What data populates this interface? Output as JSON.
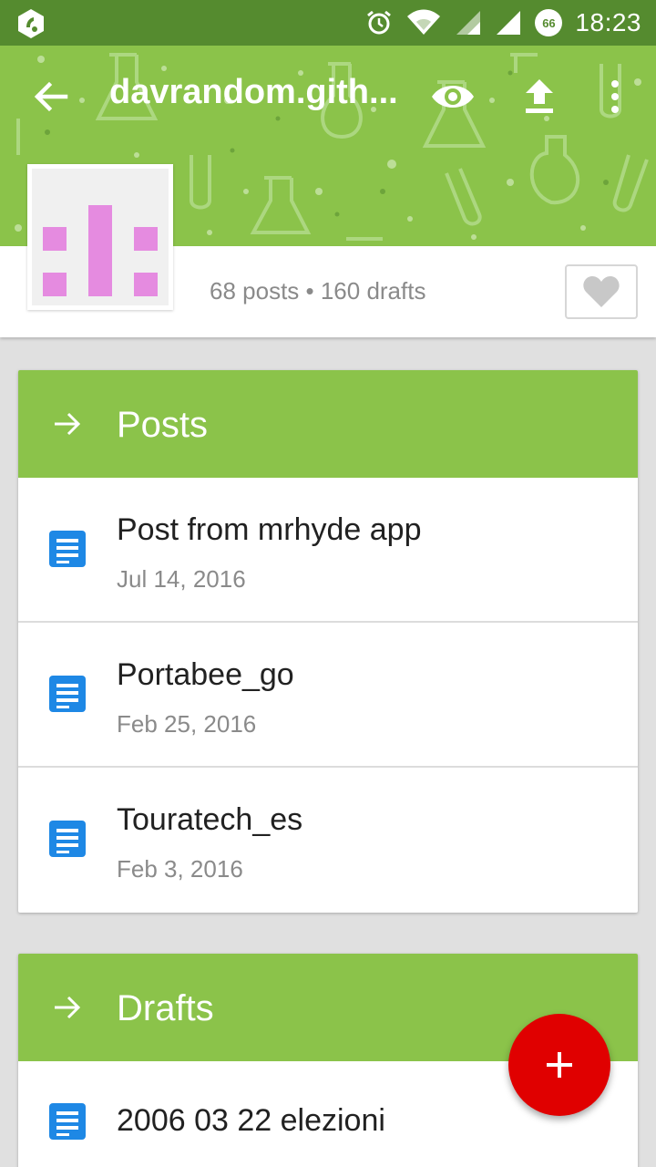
{
  "status_bar": {
    "time": "18:23",
    "battery": "66",
    "icons": [
      "notification-app-icon",
      "alarm-icon",
      "wifi-icon",
      "signal-icon",
      "battery-icon"
    ]
  },
  "toolbar": {
    "title": "davrandom.gith...",
    "actions": [
      "back-arrow-icon",
      "eye-icon",
      "upload-icon",
      "more-vert-icon"
    ]
  },
  "profile": {
    "stats": "68 posts • 160 drafts"
  },
  "posts": {
    "header": "Posts",
    "items": [
      {
        "title": "Post from mrhyde app",
        "date": "Jul 14, 2016"
      },
      {
        "title": "Portabee_go",
        "date": "Feb 25, 2016"
      },
      {
        "title": "Touratech_es",
        "date": "Feb 3, 2016"
      }
    ]
  },
  "drafts": {
    "header": "Drafts",
    "items": [
      {
        "title": "2006 03 22 elezioni"
      }
    ]
  },
  "fab": {
    "icon": "add-icon"
  },
  "colors": {
    "status_bar": "#558b2f",
    "primary": "#8bc34a",
    "fab": "#e00000",
    "doc_icon": "#1e88e5",
    "avatar_pink": "#e58be0"
  }
}
